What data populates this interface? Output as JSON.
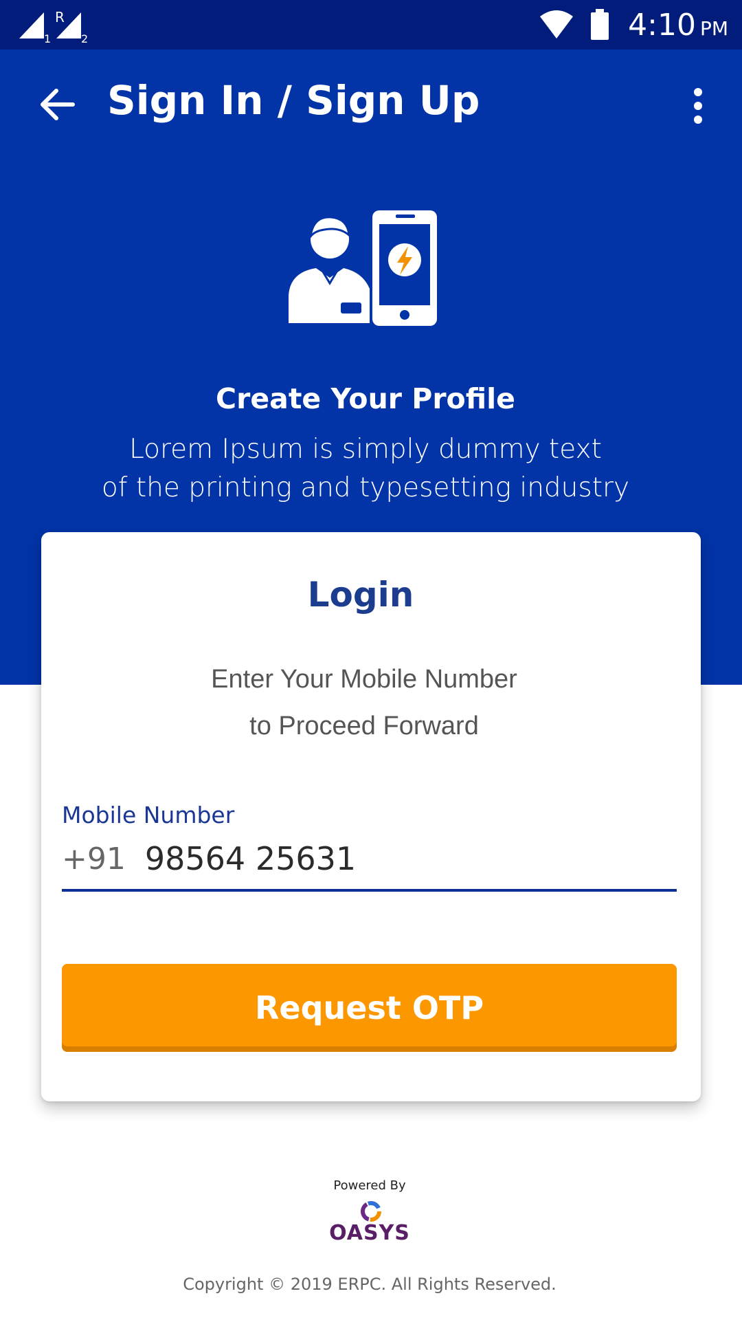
{
  "status_bar": {
    "sim1": "1",
    "sim_r": "R",
    "sim2": "2",
    "time": "4:10",
    "ampm": "PM"
  },
  "appbar": {
    "title": "Sign In / Sign Up"
  },
  "hero": {
    "title": "Create Your Profile",
    "subtitle_line1": "Lorem Ipsum is simply dummy text",
    "subtitle_line2": "of the printing and typesetting industry"
  },
  "card": {
    "title": "Login",
    "desc_line1": "Enter Your Mobile Number",
    "desc_line2": "to Proceed Forward",
    "field_label": "Mobile Number",
    "country_code": "+91",
    "phone_value": "98564 25631",
    "button_label": "Request OTP"
  },
  "footer": {
    "powered_by": "Powered By",
    "brand": "OASYS",
    "copyright": "Copyright © 2019 ERPC. All Rights Reserved."
  },
  "colors": {
    "status_bar": "#021c7c",
    "primary": "#0234a7",
    "accent": "#fc9700",
    "title_blue": "#1c3c8e"
  },
  "icons": {
    "signal1": "signal-icon",
    "signal2": "signal-icon",
    "wifi": "wifi-icon",
    "battery": "battery-icon",
    "back": "arrow-left-icon",
    "more": "more-vertical-icon"
  }
}
